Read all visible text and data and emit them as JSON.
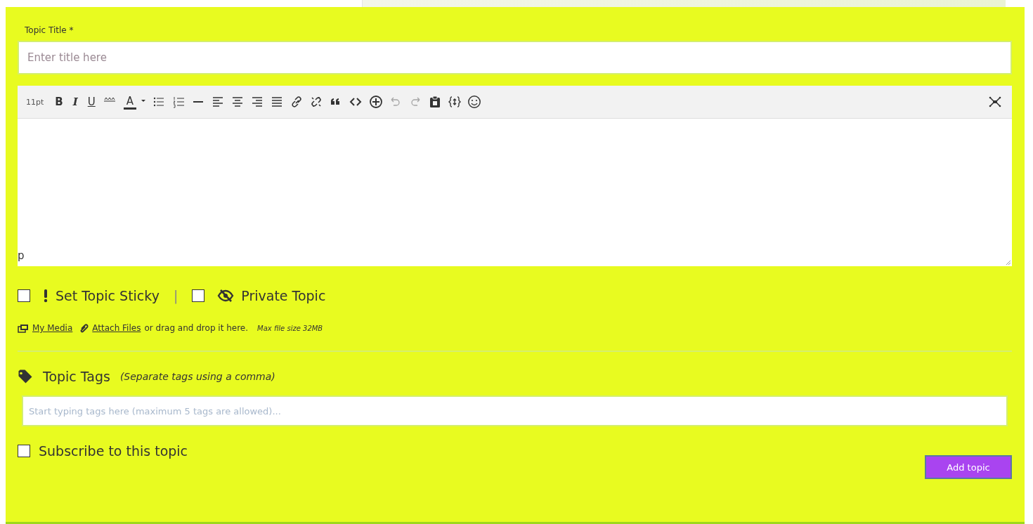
{
  "title_field": {
    "label": "Topic Title *",
    "placeholder": "Enter title here"
  },
  "toolbar": {
    "font_size": "11pt",
    "buttons": [
      {
        "kind": "bold",
        "label": "B",
        "disabled": false
      },
      {
        "kind": "italic",
        "label": "I",
        "disabled": false
      },
      {
        "kind": "underline",
        "label": "U",
        "disabled": false
      },
      {
        "kind": "strike",
        "disabled": false
      },
      {
        "kind": "textcolor",
        "label": "A",
        "disabled": false
      },
      {
        "kind": "caret",
        "disabled": false
      },
      {
        "kind": "bullets",
        "disabled": false
      },
      {
        "kind": "numbers",
        "disabled": false
      },
      {
        "kind": "hr",
        "disabled": false
      },
      {
        "kind": "alignleft",
        "disabled": false
      },
      {
        "kind": "aligncenter",
        "disabled": false
      },
      {
        "kind": "alignright",
        "disabled": false
      },
      {
        "kind": "justify",
        "disabled": false
      },
      {
        "kind": "link",
        "disabled": false
      },
      {
        "kind": "unlink",
        "disabled": false
      },
      {
        "kind": "quote",
        "disabled": false
      },
      {
        "kind": "code",
        "disabled": false
      },
      {
        "kind": "plus",
        "disabled": false
      },
      {
        "kind": "undo",
        "disabled": true
      },
      {
        "kind": "redo",
        "disabled": true
      },
      {
        "kind": "paste",
        "disabled": false
      },
      {
        "kind": "braces",
        "disabled": false
      },
      {
        "kind": "emoji",
        "disabled": false
      }
    ]
  },
  "editor": {
    "status_path": "p"
  },
  "options": [
    {
      "kind": "sticky",
      "label": "Set Topic Sticky",
      "checked": false
    },
    {
      "kind": "private",
      "label": "Private Topic",
      "checked": false
    }
  ],
  "separator": "|",
  "attachments": {
    "media_link": "My Media",
    "files_link": "Attach Files",
    "text": "or drag and drop it here.",
    "note": "Max file size 32MB"
  },
  "tags": {
    "label": "Topic Tags",
    "hint": "(Separate tags using a comma)",
    "placeholder": "Start typing tags here (maximum 5 tags are allowed)..."
  },
  "subscribe": {
    "label": "Subscribe to this topic",
    "checked": false
  },
  "submit_button": "Add topic"
}
